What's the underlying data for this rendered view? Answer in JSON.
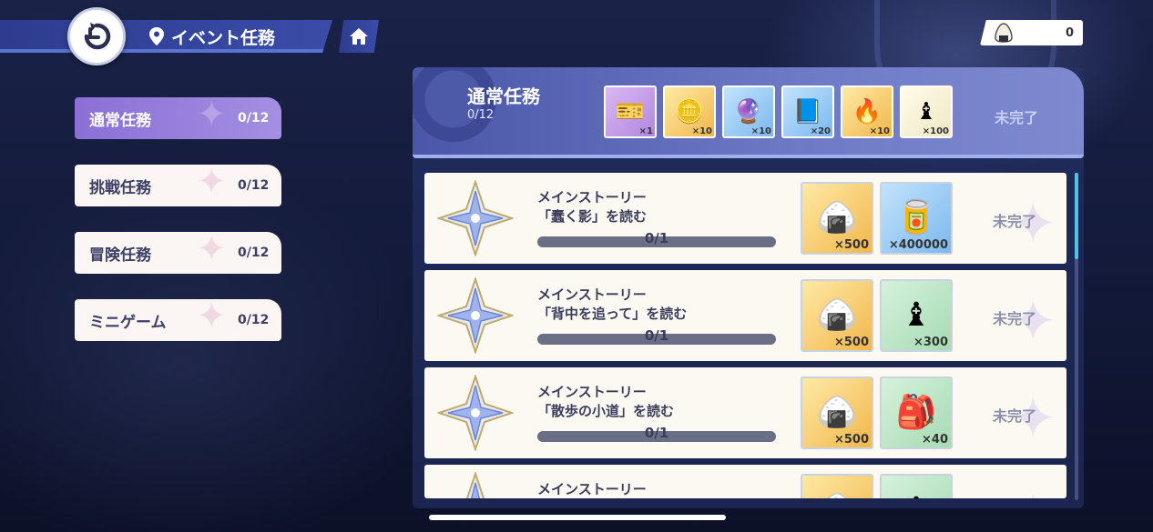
{
  "header": {
    "title": "イベント任務"
  },
  "currency": {
    "value": "0"
  },
  "tabs": [
    {
      "label": "通常任務",
      "count": "0/12"
    },
    {
      "label": "挑戦任務",
      "count": "0/12"
    },
    {
      "label": "冒険任務",
      "count": "0/12"
    },
    {
      "label": "ミニゲーム",
      "count": "0/12"
    }
  ],
  "summary": {
    "title": "通常任務",
    "count": "0/12",
    "status": "未完了",
    "rewards": [
      {
        "icon": "ticket-icon",
        "qty": "×1"
      },
      {
        "icon": "gold-coin-icon",
        "qty": "×10"
      },
      {
        "icon": "crystal-orb-icon",
        "qty": "×10"
      },
      {
        "icon": "book-icon",
        "qty": "×20"
      },
      {
        "icon": "fire-bowl-icon",
        "qty": "×10"
      },
      {
        "icon": "chess-piece-icon",
        "qty": "×100"
      }
    ]
  },
  "quests": [
    {
      "line1": "メインストーリー",
      "line2": "「蠢く影」を読む",
      "progress_label": "0/1",
      "progress": 0,
      "status": "未完了",
      "rewards": [
        {
          "icon": "rice-ball-icon",
          "qty": "×500"
        },
        {
          "icon": "blue-can-icon",
          "qty": "×400000"
        }
      ]
    },
    {
      "line1": "メインストーリー",
      "line2": "「背中を追って」を読む",
      "progress_label": "0/1",
      "progress": 0,
      "status": "未完了",
      "rewards": [
        {
          "icon": "rice-ball-icon",
          "qty": "×500"
        },
        {
          "icon": "chess-piece-icon",
          "qty": "×300"
        }
      ]
    },
    {
      "line1": "メインストーリー",
      "line2": "「散歩の小道」を読む",
      "progress_label": "0/1",
      "progress": 0,
      "status": "未完了",
      "rewards": [
        {
          "icon": "rice-ball-icon",
          "qty": "×500"
        },
        {
          "icon": "green-bag-icon",
          "qty": "×40"
        }
      ]
    },
    {
      "line1": "メインストーリー",
      "line2": "",
      "progress_label": "",
      "progress": 0,
      "status": "",
      "rewards": [
        {
          "icon": "rice-ball-icon",
          "qty": ""
        },
        {
          "icon": "chess-piece-icon",
          "qty": ""
        }
      ]
    }
  ]
}
